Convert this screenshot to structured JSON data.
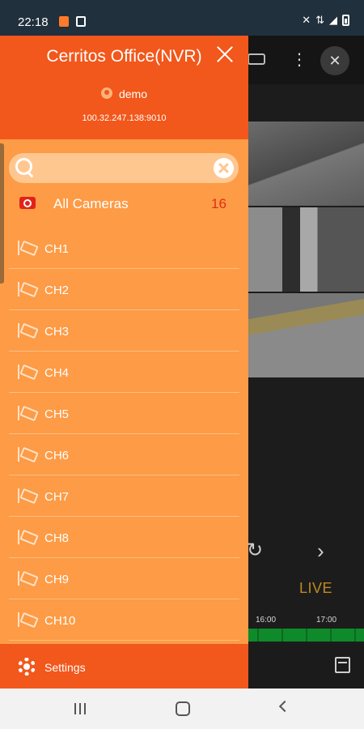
{
  "status_bar": {
    "time": "22:18"
  },
  "background_view": {
    "live_label": "LIVE",
    "timeline_ticks": [
      "16:00",
      "17:00"
    ]
  },
  "drawer": {
    "device_name": "Cerritos Office(NVR)",
    "user": "demo",
    "ip": "100.32.247.138:9010",
    "search": {
      "placeholder": "",
      "value": ""
    },
    "all_cameras": {
      "label": "All Cameras",
      "count": "16"
    },
    "channels": [
      "CH1",
      "CH2",
      "CH3",
      "CH4",
      "CH5",
      "CH6",
      "CH7",
      "CH8",
      "CH9",
      "CH10"
    ],
    "settings_label": "Settings"
  },
  "colors": {
    "header_orange": "#f2571b",
    "drawer_orange": "#fd9b46",
    "count_red": "#e03010",
    "live_gold": "#c08a1e",
    "timeline_green": "#0f8a2a"
  }
}
